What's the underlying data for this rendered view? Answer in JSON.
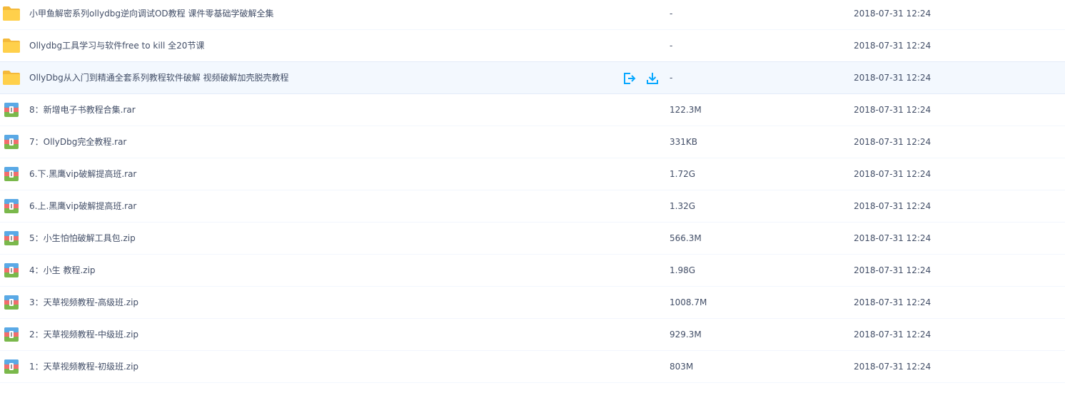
{
  "colors": {
    "text": "#424e67",
    "folder": "#ffd04b",
    "folder_tab": "#f4b93a",
    "hover_row": "#f3f8fe",
    "action_blue": "#06a7ff"
  },
  "files": [
    {
      "name": "小甲鱼解密系列ollydbg逆向调试OD教程 课件零基础学破解全集",
      "size": "-",
      "time": "2018-07-31 12:24",
      "icon": "folder-icon"
    },
    {
      "name": "Ollydbg工具学习与软件free to kill 全20节课",
      "size": "-",
      "time": "2018-07-31 12:24",
      "icon": "folder-icon"
    },
    {
      "name": "OllyDbg从入门到精通全套系列教程软件破解 视频破解加壳脱壳教程",
      "size": "-",
      "time": "2018-07-31 12:24",
      "icon": "folder-icon"
    },
    {
      "name": "8：新增电子书教程合集.rar",
      "size": "122.3M",
      "time": "2018-07-31 12:24",
      "icon": "archive-icon"
    },
    {
      "name": "7：OllyDbg完全教程.rar",
      "size": "331KB",
      "time": "2018-07-31 12:24",
      "icon": "archive-icon"
    },
    {
      "name": "6.下.黑鹰vip破解提高班.rar",
      "size": "1.72G",
      "time": "2018-07-31 12:24",
      "icon": "archive-icon"
    },
    {
      "name": "6.上.黑鹰vip破解提高班.rar",
      "size": "1.32G",
      "time": "2018-07-31 12:24",
      "icon": "archive-icon"
    },
    {
      "name": "5：小生怕怕破解工具包.zip",
      "size": "566.3M",
      "time": "2018-07-31 12:24",
      "icon": "archive-icon"
    },
    {
      "name": "4：小生 教程.zip",
      "size": "1.98G",
      "time": "2018-07-31 12:24",
      "icon": "archive-icon"
    },
    {
      "name": "3：天草视频教程-高级班.zip",
      "size": "1008.7M",
      "time": "2018-07-31 12:24",
      "icon": "archive-icon"
    },
    {
      "name": "2：天草视频教程-中级班.zip",
      "size": "929.3M",
      "time": "2018-07-31 12:24",
      "icon": "archive-icon"
    },
    {
      "name": "1：天草视频教程-初级班.zip",
      "size": "803M",
      "time": "2018-07-31 12:24",
      "icon": "archive-icon"
    }
  ],
  "hover_actions": [
    "share-icon",
    "download-icon"
  ]
}
